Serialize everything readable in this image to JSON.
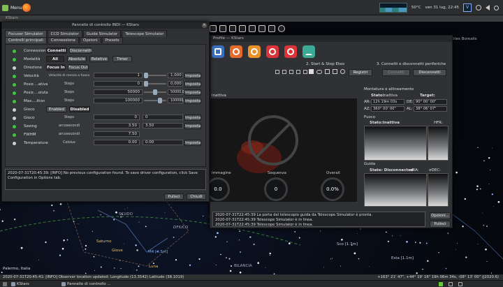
{
  "system_panel": {
    "menu_label": "Menu",
    "temperature": "50°C",
    "datetime": "ven 31 lug, 22:45",
    "keyboard_badge": "V"
  },
  "kstars": {
    "title": "KStars",
    "sky_labels": [
      "Boötes Borealis",
      "SCUDO",
      "OFIUCO",
      "Saturno",
      "Giove",
      "Luna",
      "BILANCIA",
      "M4 [4.5m]",
      "Sco [1.7m]",
      "Esta [1.1m]"
    ],
    "location": "Palermo, Italia",
    "status_left": "2020-07-31T20:45:41: [INFO] Observer location updated: Longitude (13.3542) Latitude (38.1019)",
    "status_right": "+163° 21' 47\", +44° 19' 16\"  19h 06m 34s, -08° 13' 00\" (J2020.6)"
  },
  "indi": {
    "title": "Pannello di controllo INDI — KStars",
    "device_tabs": [
      "Focuser Simulator",
      "CCD Simulator",
      "Guide Simulator",
      "Telescope Simulator"
    ],
    "group_tabs": [
      "Controlli principali",
      "Connessione",
      "Opzioni",
      "Presets"
    ],
    "rows": {
      "connection": {
        "label": "Connessione",
        "on": "Connetti",
        "off": "Disconnetti"
      },
      "mode": {
        "label": "Modalità",
        "all": "All",
        "absolute": "Absolute",
        "relative": "Relative",
        "timer": "Timer"
      },
      "direction": {
        "label": "Direzione",
        "in": "Focus In",
        "out": "Focus Out"
      },
      "speed": {
        "label": "Velocità",
        "elem": "Velocità di messa a fuoco",
        "value": "1",
        "target": "1,000",
        "set": "Imposta"
      },
      "rel_pos": {
        "label": "Posiz....ativa",
        "elem": "Steps",
        "value": "0",
        "target": "0,000",
        "set": "Imposta"
      },
      "abs_pos": {
        "label": "Posiz....oluta",
        "elem": "Steps",
        "value": "50000",
        "target": "50000,0",
        "set": "Imposta"
      },
      "max": {
        "label": "Max....ition",
        "elem": "Steps",
        "value": "100000",
        "target": "100000,",
        "set": "Imposta"
      },
      "backlash_toggle": {
        "label": "Gioco",
        "enabled": "Enabled",
        "disabled": "Disabled"
      },
      "backlash": {
        "label": "Gioco",
        "elem": "Steps",
        "value": "0",
        "target": "0",
        "set": "Imposta"
      },
      "seeing": {
        "label": "Seeing",
        "elem": "arcosecondi",
        "value": "3.50",
        "target": "3.50",
        "set": "Imposta"
      },
      "fwhm": {
        "label": "FWHM",
        "elem": "arcosecondi",
        "value": "7.50"
      },
      "temperature": {
        "label": "Temperature",
        "elem": "Celsius",
        "value": "0.00",
        "target": "0.00",
        "set": "Imposta"
      }
    },
    "log": "2020-07-31T20:45:39: [INFO] No previous configuration found. To save driver configuration, click Save Configuration in Options tab.",
    "clear_button": "Pulisci",
    "close_button": "Chiudi"
  },
  "ekos": {
    "title": "Profile — KStars",
    "step2": "2. Start & Stop Ekos",
    "step3": "3. Connetti e disconnetti periferiche",
    "register_button": "Registri",
    "connect_button": "Connetti",
    "disconnect_button": "Disconnetti",
    "view_title": "inattiva",
    "mount_title": "Montatura e allineamento",
    "mount_state_label": "Stato:",
    "mount_state": "Inattiva",
    "target_label": "Target:",
    "ra_label": "AR:",
    "ra_value": "12h 19m 03s",
    "de_label": "DE:",
    "de_value": "90° 00' 00\"",
    "az_label": "AZ:",
    "az_value": "360° 00' 00\"",
    "al_label": "AL:",
    "al_value": "38° 06' 07\"",
    "focus_title": "Fuoco",
    "focus_state": "Stato:Inattiva",
    "hfr_label": "HFR:",
    "guide_title": "Guida",
    "guide_state": "State: Disconnected",
    "dra_label": "σRA:",
    "ddec_label": "σDEC:",
    "gauges": [
      {
        "label": "Immagine",
        "value": "0.0"
      },
      {
        "label": "Sequenza",
        "value": "0"
      },
      {
        "label": "Overall",
        "value": "0.0%"
      }
    ],
    "log_lines": [
      "2020-07-31T22:45:39 La porta del telescopio guida da Telescope Simulator è pronta.",
      "2020-07-31T22:45:39 Telescope Simulator è in linea.",
      "2020-07-31T22:45:39 Telescope Simulator è in linea."
    ],
    "options_button": "Opzioni...",
    "clear_button": "Pulisci"
  },
  "taskbar": {
    "items": [
      "KStars",
      "Pannello di controllo ..."
    ]
  },
  "colors": {
    "led_on": "#3ec43e",
    "led_idle": "#cfcfcf"
  }
}
